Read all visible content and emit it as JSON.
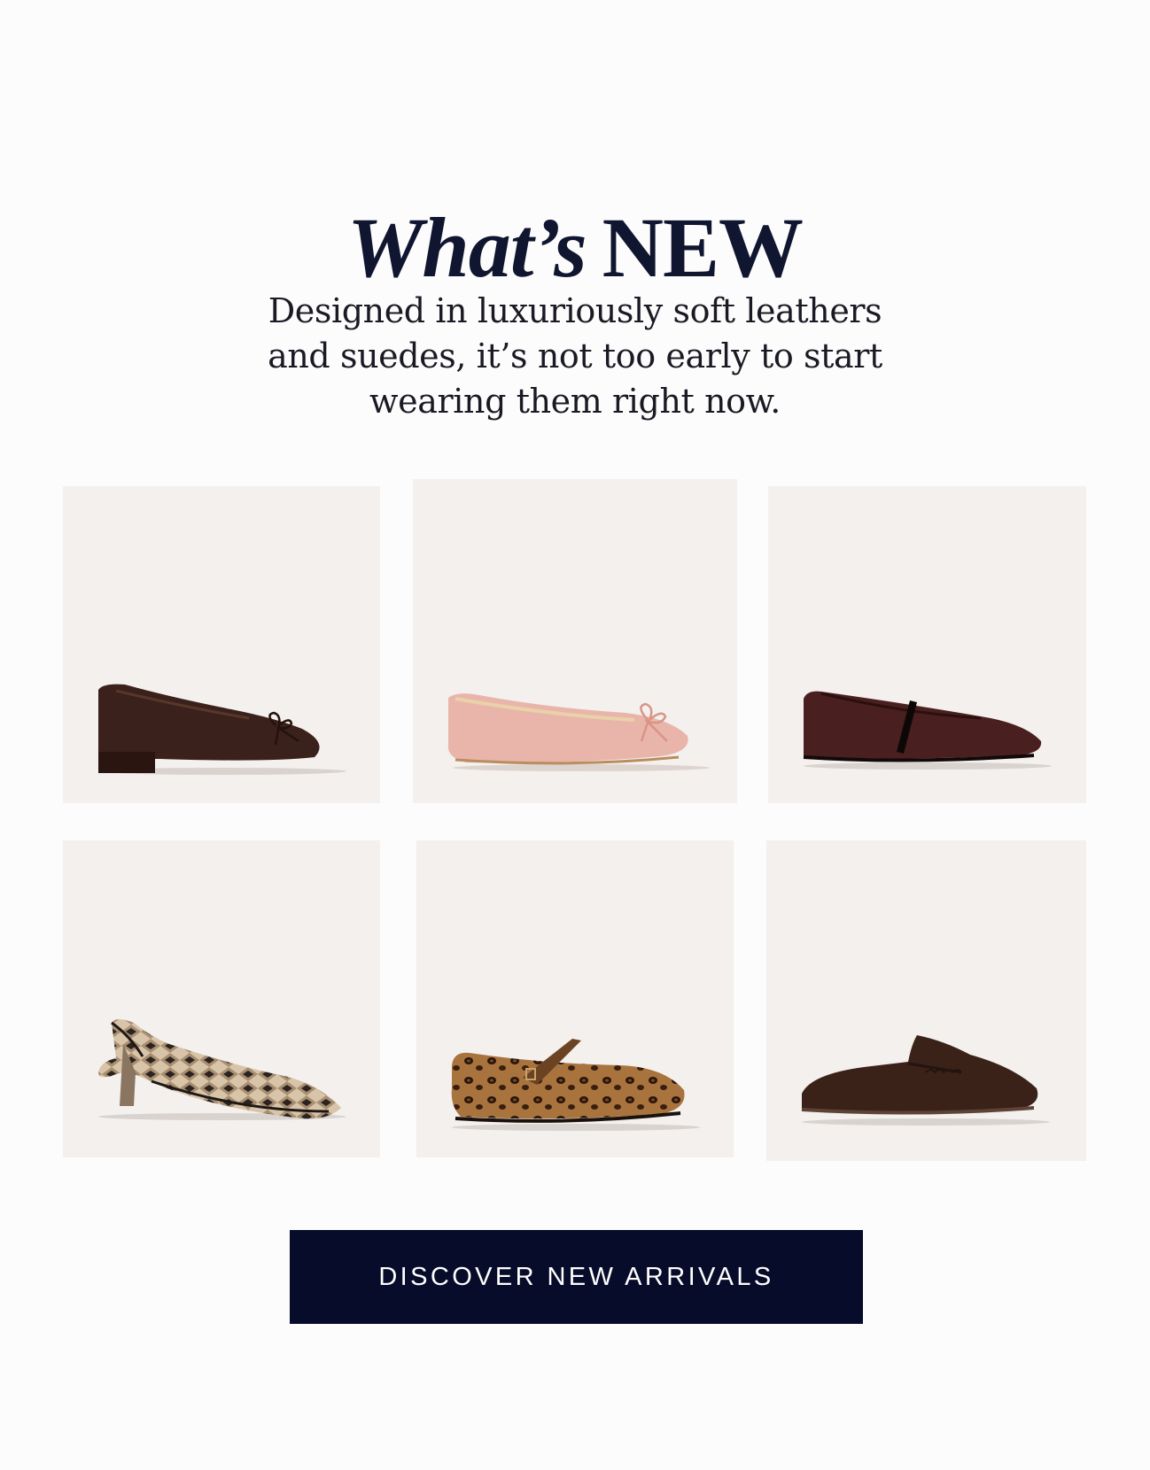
{
  "header": {
    "title_italic": "What’s",
    "title_caps": "NEW"
  },
  "intro": {
    "line1": "Designed in luxuriously soft leathers",
    "line2": "and suedes, it’s not too early to start",
    "line3": "wearing them right now."
  },
  "products": [
    {
      "name": "brown suede bow block-heel flat",
      "color": "#3a211b"
    },
    {
      "name": "pink satin bow ballet flat",
      "color": "#e9b5aa"
    },
    {
      "name": "burgundy leather strap flat",
      "color": "#4a1f1f"
    },
    {
      "name": "snakeskin slingback kitten heel",
      "color": "#cdb79a"
    },
    {
      "name": "leopard print mary jane flat",
      "color": "#7a4a25"
    },
    {
      "name": "brown suede penny mule loafer",
      "color": "#3a2219"
    }
  ],
  "cta": {
    "label": "DISCOVER NEW ARRIVALS",
    "background": "#070c2a"
  }
}
